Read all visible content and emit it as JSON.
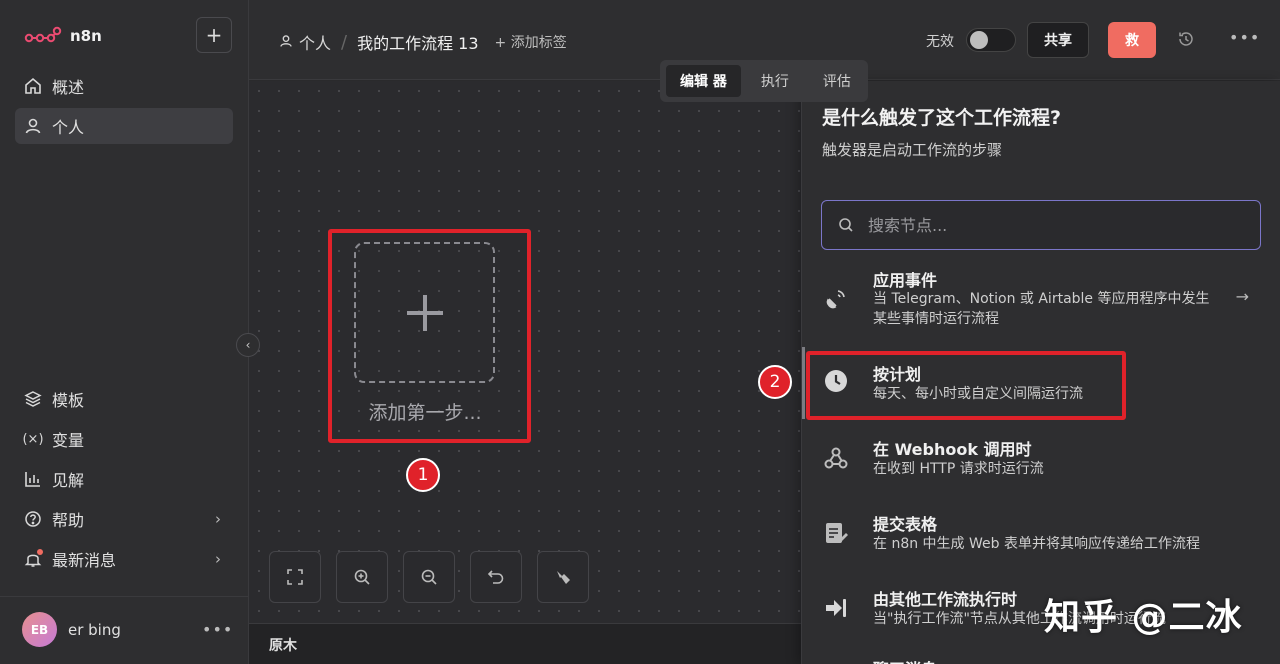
{
  "app": {
    "name": "n8n"
  },
  "sidebar": {
    "nav": [
      {
        "label": "概述",
        "icon": "home-icon"
      },
      {
        "label": "个人",
        "icon": "user-icon"
      }
    ],
    "bottom_nav": [
      {
        "label": "模板",
        "icon": "template-icon"
      },
      {
        "label": "变量",
        "icon": "variable-icon"
      },
      {
        "label": "见解",
        "icon": "chart-icon"
      },
      {
        "label": "帮助",
        "icon": "help-icon"
      },
      {
        "label": "最新消息",
        "icon": "bell-icon"
      }
    ],
    "user": {
      "initials": "EB",
      "name": "er bing"
    }
  },
  "header": {
    "breadcrumb_project": "个人",
    "workflow_title": "我的工作流程 13",
    "add_tag": "+ 添加标签",
    "inactive_label": "无效",
    "share_label": "共享",
    "save_label": "救"
  },
  "tabs": [
    "编辑 器",
    "执行",
    "评估"
  ],
  "canvas": {
    "add_first_step": "添加第一步...",
    "bottom_label": "原木"
  },
  "annotations": {
    "badge1": "1",
    "badge2": "2"
  },
  "panel": {
    "title": "是什么触发了这个工作流程?",
    "subtitle": "触发器是启动工作流的步骤",
    "search_placeholder": "搜索节点...",
    "items": [
      {
        "title": "应用事件",
        "desc": "当 Telegram、Notion 或 Airtable 等应用程序中发生某些事情时运行流程",
        "icon": "satellite-icon"
      },
      {
        "title": "按计划",
        "desc": "每天、每小时或自定义间隔运行流",
        "icon": "clock-icon"
      },
      {
        "title": "在 Webhook 调用时",
        "desc": "在收到 HTTP 请求时运行流",
        "icon": "webhook-icon"
      },
      {
        "title": "提交表格",
        "desc": "在 n8n 中生成 Web 表单并将其响应传递给工作流程",
        "icon": "form-icon"
      },
      {
        "title": "由其他工作流执行时",
        "desc": "当\"执行工作流\"节点从其他工作流调用时运行流",
        "icon": "sign-in-icon"
      },
      {
        "title": "聊天消息",
        "desc": "",
        "icon": "chat-icon"
      }
    ]
  },
  "watermark": "知乎 @二冰",
  "colors": {
    "accent": "#f06c61",
    "highlight": "#e0222a",
    "search_border": "#7b76c9"
  }
}
